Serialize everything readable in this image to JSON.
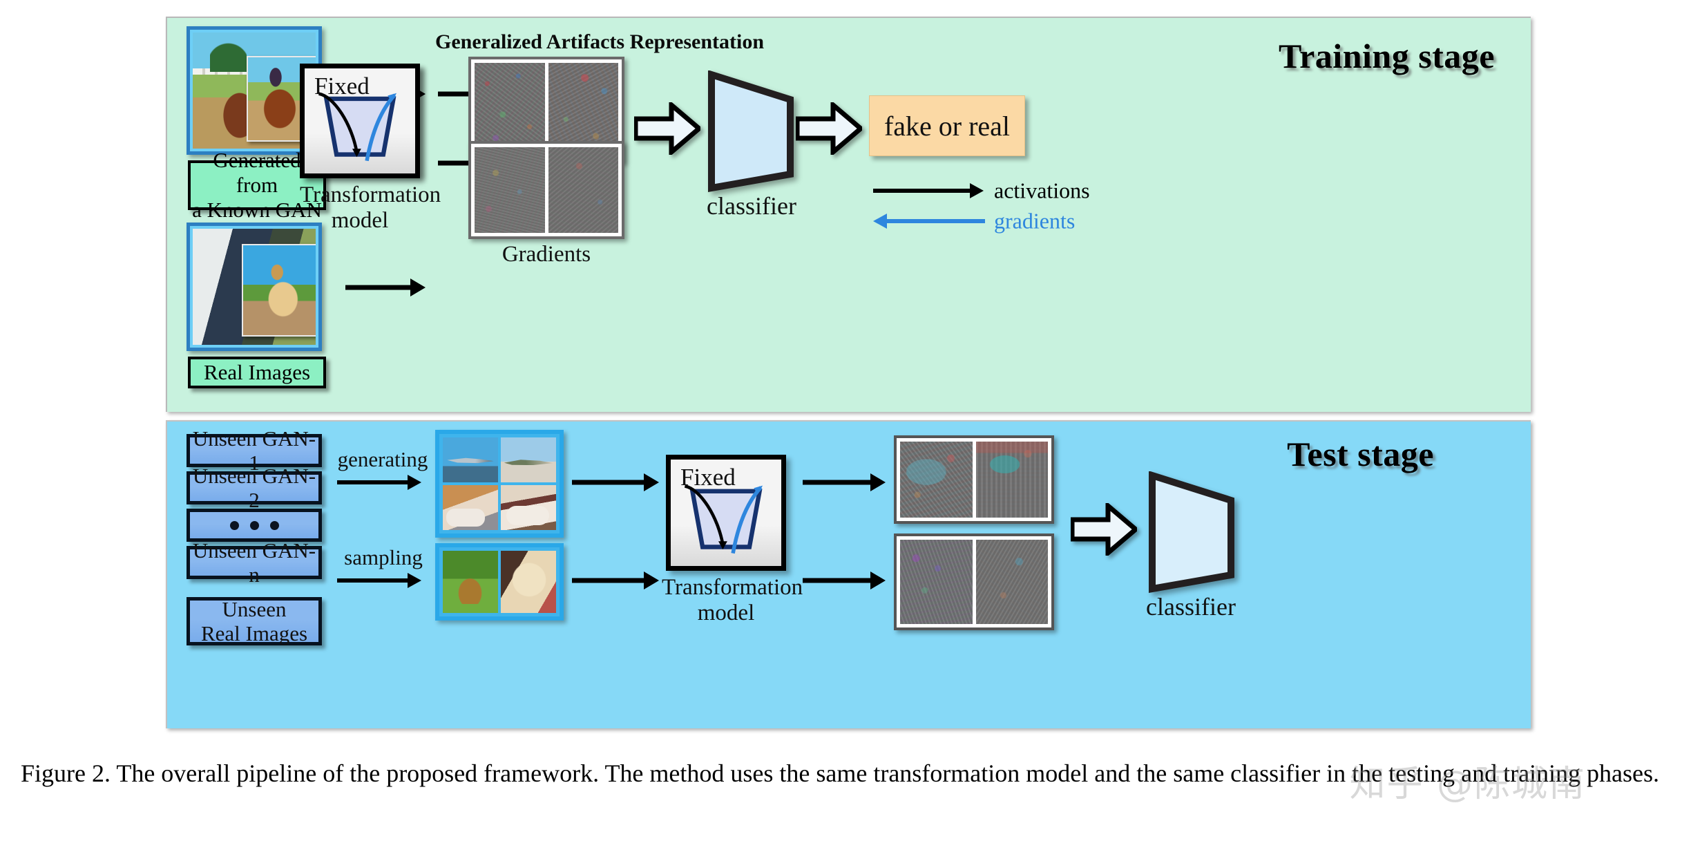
{
  "figure": {
    "caption": "Figure 2. The overall pipeline of the proposed framework. The method uses the same transformation model and the same classifier in the testing and training phases.",
    "watermark": "知乎 @陈城南"
  },
  "training_stage": {
    "title": "Training stage",
    "bg_color": "#c8f2de",
    "inputs": [
      {
        "caption": "Generated from\na Known GAN",
        "caption_line1": "Generated from",
        "caption_line2": "a Known GAN"
      },
      {
        "caption": "Real Images",
        "caption_line1": "Real Images",
        "caption_line2": ""
      }
    ],
    "transformation": {
      "fixed_label": "Fixed",
      "label_line1": "Transformation",
      "label_line2": "model"
    },
    "artifacts_title": "Generalized Artifacts Representation",
    "gradients_label": "Gradients",
    "classifier_label": "classifier",
    "output_label": "fake or real",
    "output_color": "#fbd9a5",
    "legend": {
      "activations": "activations",
      "gradients": "gradients",
      "activations_color": "#000000",
      "gradients_color": "#2e86de"
    }
  },
  "test_stage": {
    "title": "Test stage",
    "bg_color": "#86d9f7",
    "gan_boxes": [
      {
        "label": "Unseen GAN-1",
        "type": "text"
      },
      {
        "label": "Unseen GAN-2",
        "type": "text"
      },
      {
        "label": "",
        "type": "dots"
      },
      {
        "label": "Unseen GAN-n",
        "type": "text"
      }
    ],
    "real_box": {
      "line1": "Unseen",
      "line2": "Real Images"
    },
    "arrow_labels": {
      "generating": "generating",
      "sampling": "sampling"
    },
    "transformation": {
      "fixed_label": "Fixed",
      "label_line1": "Transformation",
      "label_line2": "model"
    },
    "classifier_label": "classifier"
  }
}
